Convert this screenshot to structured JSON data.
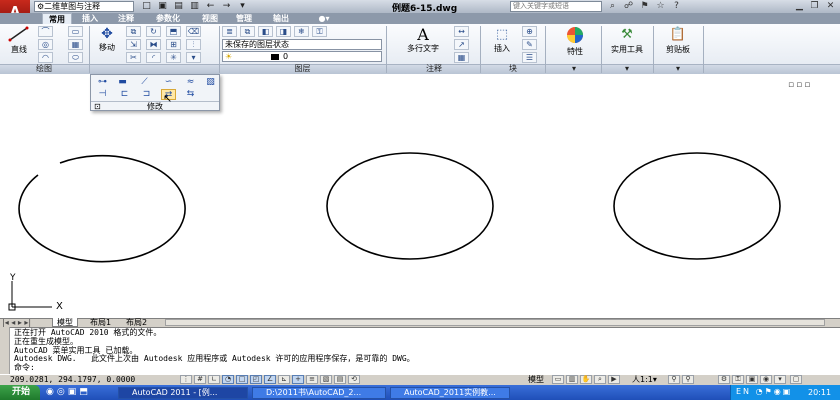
{
  "titlebar": {
    "logo_glyph": "A",
    "workspace": "二维草图与注释",
    "document_title": "例题6-15.dwg",
    "search_placeholder": "键入关键字或短语",
    "quick_access": [
      "□",
      "▣",
      "▤",
      "▥",
      "←",
      "→",
      "▾"
    ]
  },
  "tabs": [
    "常用",
    "插入",
    "注释",
    "参数化",
    "视图",
    "管理",
    "输出",
    "●▾"
  ],
  "ribbon": {
    "draw": {
      "line_label": "直线",
      "panel_label": "绘图"
    },
    "modify": {
      "move_label": "移动",
      "panel_label": "修改"
    },
    "layers": {
      "layer_state": "未保存的图层状态",
      "current_layer": "0",
      "panel_label": "图层"
    },
    "annotation": {
      "mtext_label": "多行文字",
      "panel_label": "注释",
      "mtext_glyph": "A"
    },
    "block": {
      "insert_label": "插入",
      "panel_label": "块"
    },
    "properties_label": "特性",
    "utilities_label": "实用工具",
    "clipboard_label": "剪贴板"
  },
  "flyout": {
    "label": "修改"
  },
  "canvas": {
    "ucs_x": "X",
    "ucs_y": "Y",
    "viewport_controls": "▫▫▫"
  },
  "layout_tabs": [
    "模型",
    "布局1",
    "布局2"
  ],
  "command_history": [
    "正在打开 AutoCAD 2010 格式的文件。",
    "正在重生成模型。",
    "AutoCAD 菜单实用工具 已加载。",
    "Autodesk DWG.   此文件上次由 Autodesk 应用程序或 Autodesk 许可的应用程序保存，是可靠的 DWG。"
  ],
  "command_prompt": "命令:",
  "status": {
    "coordinates": "209.0281, 294.1797, 0.0000",
    "model_label": "模型",
    "scale": "人1:1▾"
  },
  "taskbar": {
    "start_label": "开始",
    "tasks": [
      "AutoCAD 2011 - [例...",
      "D:\\2011书\\AutoCAD_2...",
      "AutoCAD_2011实例教..."
    ],
    "clock": "20:11"
  },
  "colors": {
    "titlebar": "#aeb8c6",
    "taskbar": "#1f4fb8",
    "logo": "#c82a1c"
  }
}
